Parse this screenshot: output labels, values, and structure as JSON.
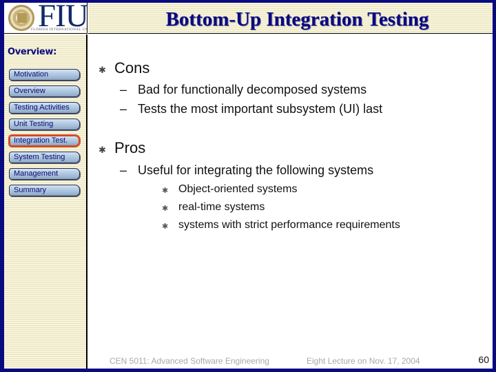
{
  "header": {
    "logo": {
      "text": "FIU",
      "subtitle": "FLORIDA INTERNATIONAL UNIVERSITY",
      "icon": "university-seal-icon"
    },
    "title": "Bottom-Up Integration Testing"
  },
  "sidebar": {
    "heading": "Overview:",
    "items": [
      {
        "label": "Motivation",
        "active": false
      },
      {
        "label": "Overview",
        "active": false
      },
      {
        "label": "Testing Activities",
        "active": false
      },
      {
        "label": "Unit Testing",
        "active": false
      },
      {
        "label": "Integration Test.",
        "active": true
      },
      {
        "label": "System Testing",
        "active": false
      },
      {
        "label": "Management",
        "active": false
      },
      {
        "label": "Summary",
        "active": false
      }
    ],
    "active_color": "#e0441c"
  },
  "content": {
    "sections": [
      {
        "bullet_icon": "asterisk-bullet-icon",
        "title": "Cons",
        "items": [
          {
            "text": "Bad for functionally decomposed systems",
            "sub": []
          },
          {
            "text": "Tests the most important subsystem (UI) last",
            "sub": []
          }
        ]
      },
      {
        "bullet_icon": "asterisk-bullet-icon",
        "title": "Pros",
        "items": [
          {
            "text": "Useful for integrating the following systems",
            "sub": [
              "Object-oriented systems",
              "real-time systems",
              "systems with strict performance requirements"
            ]
          }
        ]
      }
    ],
    "dash": "–",
    "star": "✱"
  },
  "footer": {
    "course": "CEN 5011: Advanced Software Engineering",
    "lecture": "Eight Lecture on Nov. 17, 2004",
    "page_number": "60"
  },
  "colors": {
    "frame": "#0a0a80",
    "title": "#0a0a80",
    "stripe_light": "#f7f4de",
    "stripe_dark": "#e9e3bc"
  }
}
